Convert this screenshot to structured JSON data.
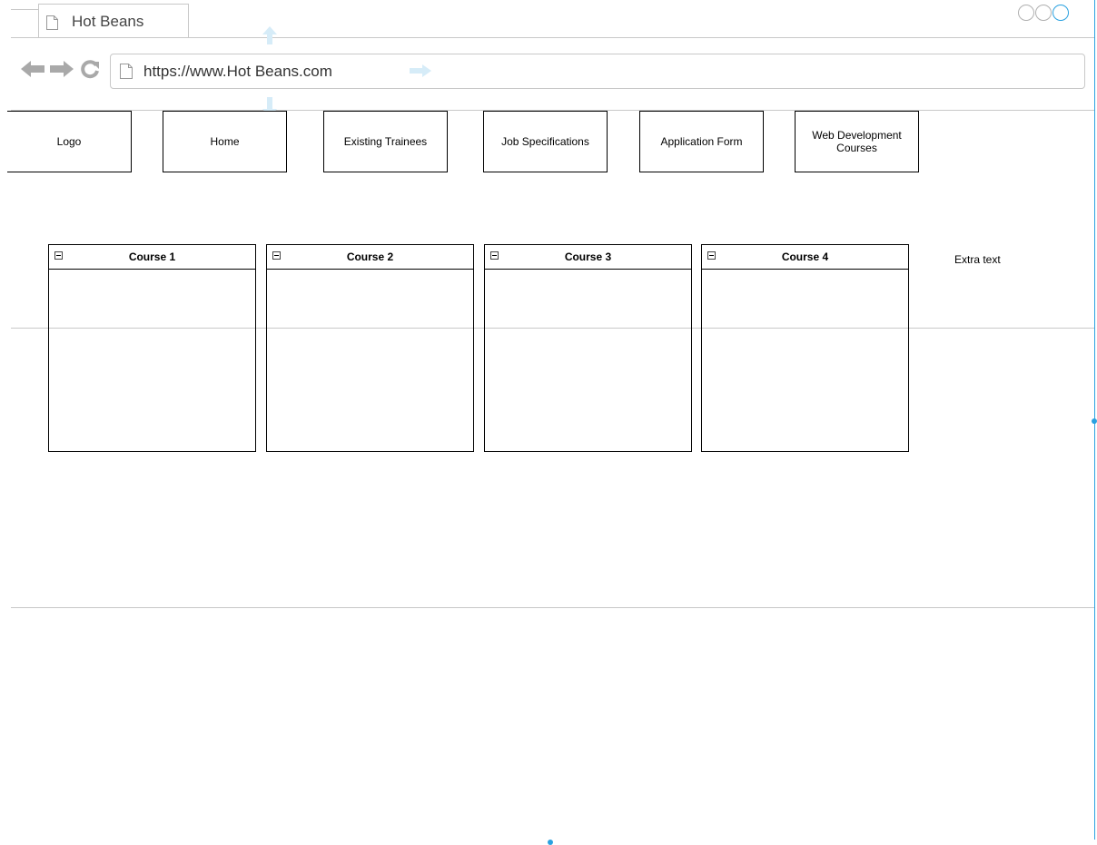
{
  "browser": {
    "tab_title": "Hot Beans",
    "url": "https://www.Hot Beans.com"
  },
  "nav": {
    "items": [
      "Logo",
      "Home",
      "Existing Trainees",
      "Job Specifications",
      "Application Form",
      "Web Development Courses"
    ]
  },
  "courses": [
    {
      "title": "Course 1"
    },
    {
      "title": "Course 2"
    },
    {
      "title": "Course 3"
    },
    {
      "title": "Course 4"
    }
  ],
  "extra_text": "Extra text",
  "icons": {
    "back": "back-arrow-icon",
    "forward": "forward-arrow-icon",
    "reload": "reload-icon",
    "page": "document-icon",
    "collapse": "collapse-icon"
  },
  "colors": {
    "chrome_gray": "#c8c8c8",
    "icon_gray": "#b0b0b0",
    "selection_blue": "#2aa1e0",
    "handle_blue": "#d6ecf8"
  }
}
